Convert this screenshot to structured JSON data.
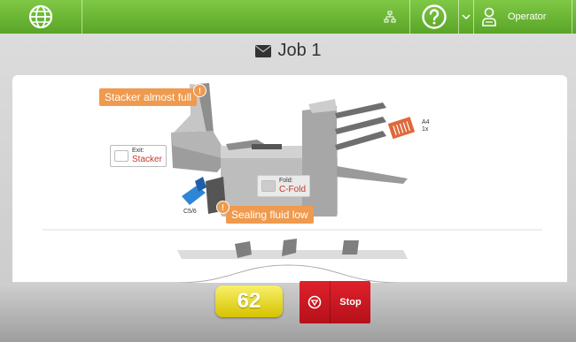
{
  "topbar": {
    "menu_icon": "globe-icon",
    "network_icon": "network-icon",
    "help_icon": "help-icon",
    "dropdown_icon": "chevron-down-icon",
    "user_icon": "user-icon",
    "user_label": "Operator"
  },
  "job": {
    "icon": "envelope-icon",
    "title": "Job 1"
  },
  "machine": {
    "warning_stacker": "Stacker almost full",
    "warning_sealing": "Sealing fluid low",
    "exit_label": "Exit:",
    "exit_value": "Stacker",
    "fold_label": "Fold:",
    "fold_value": "C-Fold",
    "feeder_label": "A4",
    "feeder_count": "1x",
    "envelope_label": "C5/6"
  },
  "controls": {
    "counter": "62",
    "stop_label": "Stop"
  },
  "colors": {
    "top_green": "#6db838",
    "warning_orange": "#ef9a4e",
    "stop_red": "#c9161f",
    "counter_yellow": "#e8dc2c"
  }
}
